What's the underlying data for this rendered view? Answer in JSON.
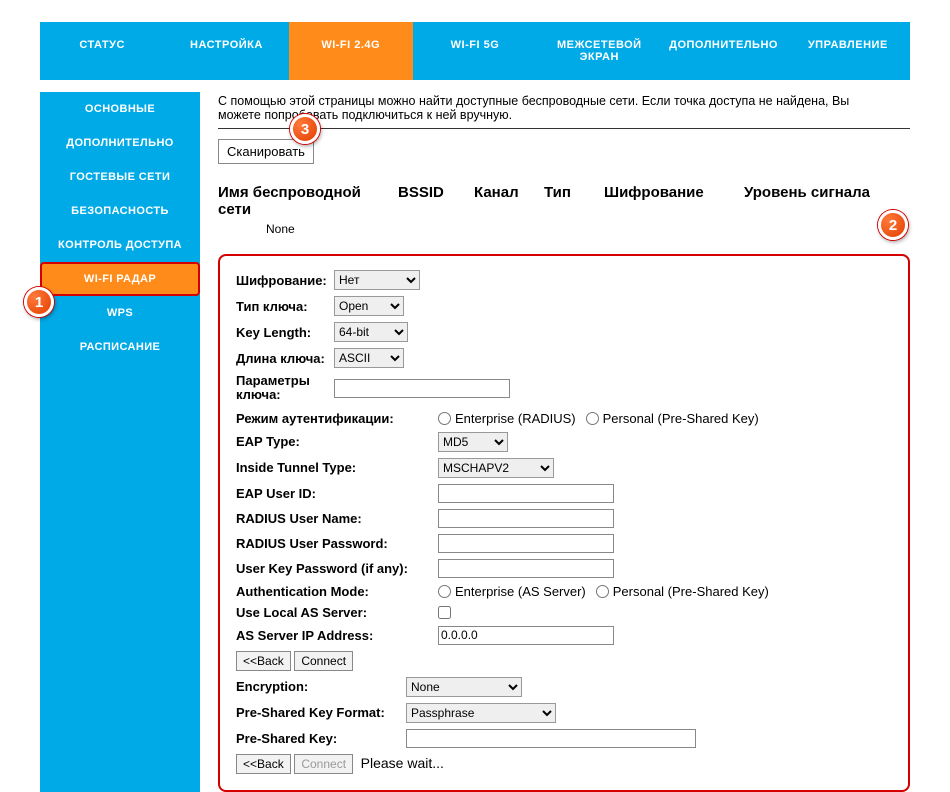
{
  "topnav": [
    {
      "label": "СТАТУС",
      "active": false
    },
    {
      "label": "НАСТРОЙКА",
      "active": false
    },
    {
      "label": "WI-FI 2.4G",
      "active": true
    },
    {
      "label": "WI-FI 5G",
      "active": false
    },
    {
      "label": "МЕЖСЕТЕВОЙ ЭКРАН",
      "active": false
    },
    {
      "label": "ДОПОЛНИТЕЛЬНО",
      "active": false
    },
    {
      "label": "УПРАВЛЕНИЕ",
      "active": false
    }
  ],
  "sidebar": [
    {
      "label": "ОСНОВНЫЕ",
      "active": false
    },
    {
      "label": "ДОПОЛНИТЕЛЬНО",
      "active": false
    },
    {
      "label": "ГОСТЕВЫЕ СЕТИ",
      "active": false
    },
    {
      "label": "БЕЗОПАСНОСТЬ",
      "active": false
    },
    {
      "label": "КОНТРОЛЬ ДОСТУПА",
      "active": false
    },
    {
      "label": "WI-FI РАДАР",
      "active": true
    },
    {
      "label": "WPS",
      "active": false
    },
    {
      "label": "РАСПИСАНИЕ",
      "active": false
    }
  ],
  "intro": "С помощью этой страницы можно найти доступные беспроводные сети. Если точка доступа не найдена, Вы можете попробовать подключиться к ней вручную.",
  "scan_btn": "Сканировать",
  "columns": {
    "ssid": "Имя беспроводной сети",
    "bssid": "BSSID",
    "channel": "Канал",
    "type": "Тип",
    "enc": "Шифрование",
    "signal": "Уровень сигнала"
  },
  "none": "None",
  "form": {
    "encryption": {
      "label": "Шифрование:",
      "value": "Нет"
    },
    "keytype": {
      "label": "Тип ключа:",
      "value": "Open"
    },
    "keylen": {
      "label": "Key Length:",
      "value": "64-bit"
    },
    "keylen2": {
      "label": "Длина ключа:",
      "value": "ASCII"
    },
    "keyparams_label": "Параметры ключа:",
    "authmode": {
      "label": "Режим аутентификации:",
      "opt1": "Enterprise (RADIUS)",
      "opt2": "Personal (Pre-Shared Key)"
    },
    "eap": {
      "label": "EAP Type:",
      "value": "MD5"
    },
    "tunnel": {
      "label": "Inside Tunnel Type:",
      "value": "MSCHAPV2"
    },
    "eapuser": "EAP User ID:",
    "radiususer": "RADIUS User Name:",
    "radiuspw": "RADIUS User Password:",
    "userkeypw": "User Key Password (if any):",
    "authmode2": {
      "label": "Authentication Mode:",
      "opt1": "Enterprise (AS Server)",
      "opt2": "Personal (Pre-Shared Key)"
    },
    "uselocal": "Use Local AS Server:",
    "asip": {
      "label": "AS Server IP Address:",
      "value": "0.0.0.0"
    },
    "back": "<<Back",
    "connect": "Connect",
    "enc2": {
      "label": "Encryption:",
      "value": "None"
    },
    "pskfmt": {
      "label": "Pre-Shared Key Format:",
      "value": "Passphrase"
    },
    "psk": "Pre-Shared Key:",
    "wait": "Please wait..."
  },
  "markers": {
    "m1": "1",
    "m2": "2",
    "m3": "3"
  }
}
